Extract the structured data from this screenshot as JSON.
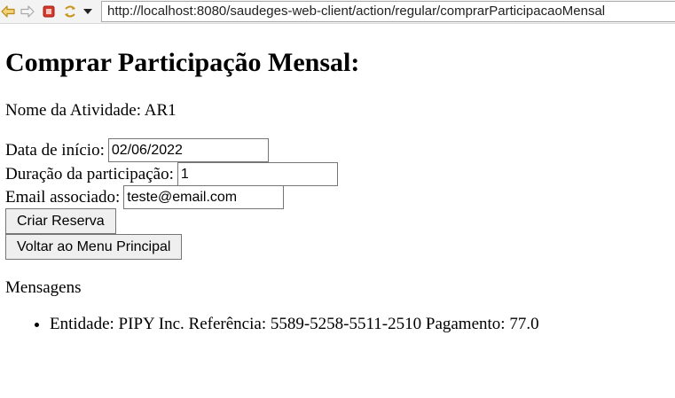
{
  "browser": {
    "url": "http://localhost:8080/saudeges-web-client/action/regular/comprarParticipacaoMensal",
    "icons": [
      "back-arrow-icon",
      "forward-arrow-icon",
      "stop-icon",
      "refresh-icon",
      "dropdown-arrow-icon"
    ]
  },
  "page": {
    "title": "Comprar Participação Mensal:",
    "activity": "Nome da Atividade: AR1",
    "start_date_label": "Data de início:",
    "start_date_value": "02/06/2022",
    "duration_label": "Duração da participação:",
    "duration_value": "1",
    "email_label": "Email associado:",
    "email_value": "teste@email.com",
    "create_button": "Criar Reserva",
    "back_button": "Voltar ao Menu Principal",
    "messages_heading": "Mensagens",
    "messages": [
      "Entidade: PIPY Inc. Referência: 5589-5258-5511-2510 Pagamento: 77.0"
    ]
  },
  "colors": {
    "toolbar_bg": "#f3f3f3",
    "back_arrow": "#d6a21a",
    "stop": "#d33a2c",
    "refresh": "#d6a21a"
  }
}
